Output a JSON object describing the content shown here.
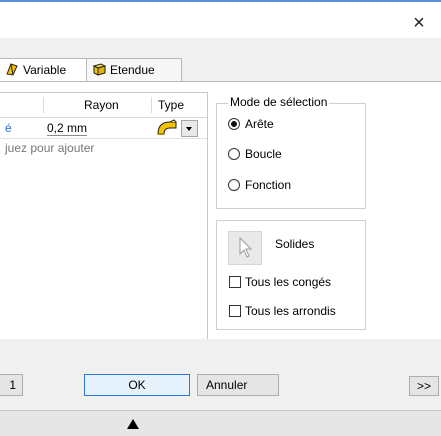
{
  "window": {
    "close_glyph": "×"
  },
  "tabs": [
    {
      "label": "Variable",
      "icon": "variable-fillet-icon"
    },
    {
      "label": "Etendue",
      "icon": "extent-icon"
    }
  ],
  "grid": {
    "columns": [
      "Rayon",
      "Type"
    ],
    "rows": [
      {
        "selection_fragment": "é",
        "rayon": "0,2 mm",
        "type_icon": "fillet-type-icon"
      }
    ],
    "hint": "juez pour ajouter"
  },
  "mode": {
    "title": "Mode de sélection",
    "options": [
      {
        "label": "Arête",
        "selected": true
      },
      {
        "label": "Boucle",
        "selected": false
      },
      {
        "label": "Fonction",
        "selected": false
      }
    ]
  },
  "solids": {
    "label": "Solides",
    "checkboxes": [
      {
        "label": "Tous les congés",
        "checked": false
      },
      {
        "label": "Tous les arrondis",
        "checked": false
      }
    ]
  },
  "buttons": {
    "left_fragment": "1",
    "ok": "OK",
    "cancel": "Annuler",
    "more": ">>"
  },
  "colors": {
    "accent": "#2f77d6",
    "link": "#2a6fd6"
  }
}
